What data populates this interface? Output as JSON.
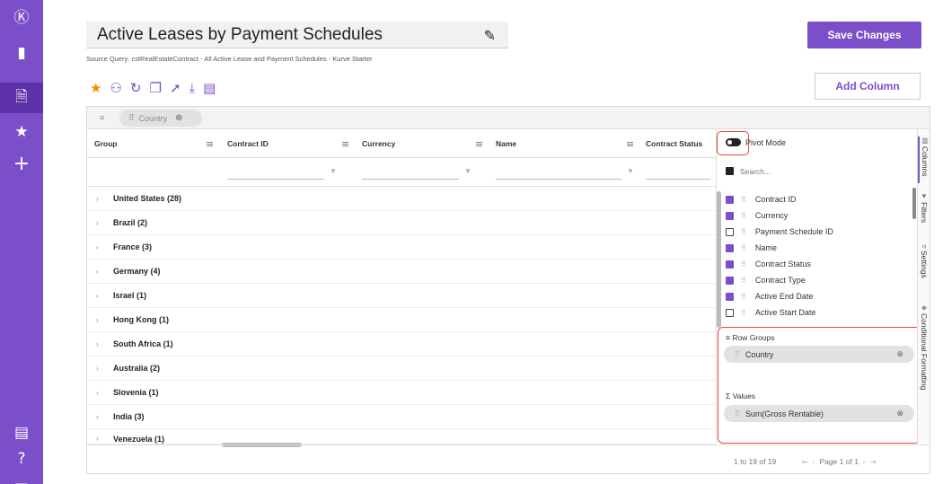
{
  "colors": {
    "brand": "#7b4fc9",
    "star": "#f28c00",
    "highlight": "#e0463a"
  },
  "sidebar": {
    "items": [
      {
        "icon": "kurve-logo-icon",
        "glyph": "Ⓚ"
      },
      {
        "icon": "bar-chart-icon",
        "glyph": "▮"
      },
      {
        "icon": "document-icon",
        "glyph": "🗎"
      },
      {
        "icon": "star-icon",
        "glyph": "★"
      },
      {
        "icon": "plus-icon",
        "glyph": "+"
      },
      {
        "icon": "settings-doc-icon",
        "glyph": "▤"
      },
      {
        "icon": "help-icon",
        "glyph": "?"
      },
      {
        "icon": "chat-icon",
        "glyph": "▭"
      }
    ]
  },
  "header": {
    "title": "Active Leases by Payment Schedules",
    "source": "Source Query: cstRealEstateContract - All Active Lease and Payment Schedules - Kurve Starter",
    "edit_glyph": "✎",
    "save_label": "Save Changes",
    "add_column_label": "Add Column"
  },
  "toolbar": {
    "icons": [
      {
        "name": "favorite-star-icon",
        "glyph": "★"
      },
      {
        "name": "user-filter-icon",
        "glyph": "⚇"
      },
      {
        "name": "refresh-icon",
        "glyph": "↻"
      },
      {
        "name": "copy-icon",
        "glyph": "❐"
      },
      {
        "name": "share-icon",
        "glyph": "➚"
      },
      {
        "name": "download-icon",
        "glyph": "⤓"
      },
      {
        "name": "list-icon",
        "glyph": "▤"
      }
    ]
  },
  "grid": {
    "group_chip": "Country",
    "columns": [
      "Group",
      "Contract ID",
      "Currency",
      "Name",
      "Contract Status"
    ],
    "rows": [
      "United States (28)",
      "Brazil (2)",
      "France (3)",
      "Germany (4)",
      "Israel (1)",
      "Hong Kong (1)",
      "South Africa (1)",
      "Australia (2)",
      "Slovenia (1)",
      "India (3)",
      "Venezuela (1)"
    ],
    "pagination": "1 to 19 of 19",
    "page_label": "Page 1 of 1"
  },
  "panel": {
    "pivot_label": "Pivot Mode",
    "search_placeholder": "Search...",
    "columns": [
      {
        "label": "Contract ID",
        "checked": true
      },
      {
        "label": "Currency",
        "checked": true
      },
      {
        "label": "Payment Schedule ID",
        "checked": false
      },
      {
        "label": "Name",
        "checked": true
      },
      {
        "label": "Contract Status",
        "checked": true
      },
      {
        "label": "Contract Type",
        "checked": true
      },
      {
        "label": "Active End Date",
        "checked": true
      },
      {
        "label": "Active Start Date",
        "checked": false
      }
    ],
    "row_groups_title": "Row Groups",
    "row_group_item": "Country",
    "values_title": "Values",
    "values_item": "Sum(Gross Rentable)"
  },
  "sidetabs": [
    "Columns",
    "Filters",
    "Settings",
    "Conditional Formatting"
  ]
}
